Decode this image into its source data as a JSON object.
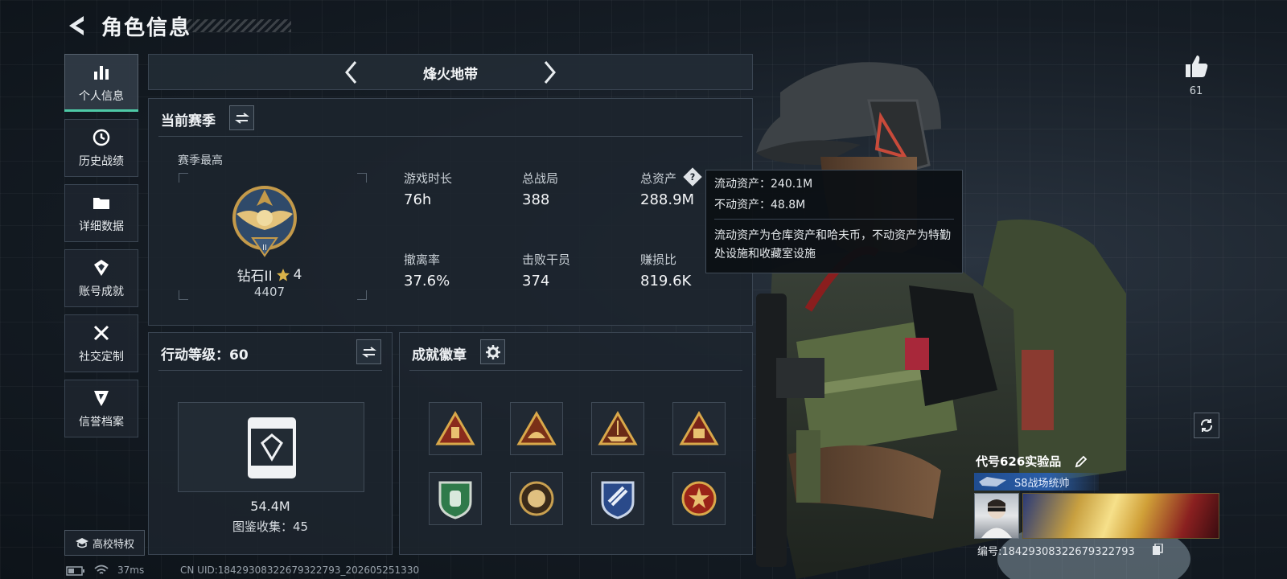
{
  "header": {
    "title": "角色信息"
  },
  "sidebar": {
    "items": [
      {
        "label": "个人信息",
        "icon": "bar-chart-icon",
        "active": true
      },
      {
        "label": "历史战绩",
        "icon": "history-icon"
      },
      {
        "label": "详细数据",
        "icon": "folder-icon"
      },
      {
        "label": "账号成就",
        "icon": "achievement-icon"
      },
      {
        "label": "社交定制",
        "icon": "tools-icon"
      },
      {
        "label": "信誉档案",
        "icon": "reputation-icon"
      }
    ],
    "campus_label": "高校特权"
  },
  "mode": {
    "name": "烽火地带"
  },
  "season": {
    "title": "当前赛季",
    "best_label": "赛季最高",
    "rank_name": "钻石II",
    "rank_stars": "4",
    "rank_points": "4407",
    "stats": [
      {
        "label": "游戏时长",
        "value": "76h"
      },
      {
        "label": "总战局",
        "value": "388"
      },
      {
        "label": "总资产",
        "value": "288.9M"
      },
      {
        "label": "撤离率",
        "value": "37.6%"
      },
      {
        "label": "击败干员",
        "value": "374"
      },
      {
        "label": "赚损比",
        "value": "819.6K"
      }
    ]
  },
  "tooltip": {
    "liquid": "流动资产：240.1M",
    "fixed": "不动资产：48.8M",
    "desc": "流动资产为仓库资产和哈夫币，不动资产为特勤处设施和收藏室设施"
  },
  "action_level": {
    "title": "行动等级：60",
    "value": "54.4M",
    "collection": "图鉴收集：45"
  },
  "badges": {
    "title": "成就徽章",
    "items": [
      "badge-triangle-1",
      "badge-triangle-2",
      "badge-triangle-3",
      "badge-triangle-4",
      "badge-shield-green",
      "badge-round-gold",
      "badge-shield-blue",
      "badge-round-red"
    ]
  },
  "profile": {
    "likes": "61",
    "name": "代号626实验品",
    "title": "S8战场统帅",
    "id": "编号:1842930832267932279​3"
  },
  "status": {
    "ping": "37ms",
    "uid": "CN UID:18429308322679322793_202605251330"
  },
  "colors": {
    "accent": "#4ec9a6",
    "panel": "#1c242d",
    "gold": "#d9b24a"
  }
}
